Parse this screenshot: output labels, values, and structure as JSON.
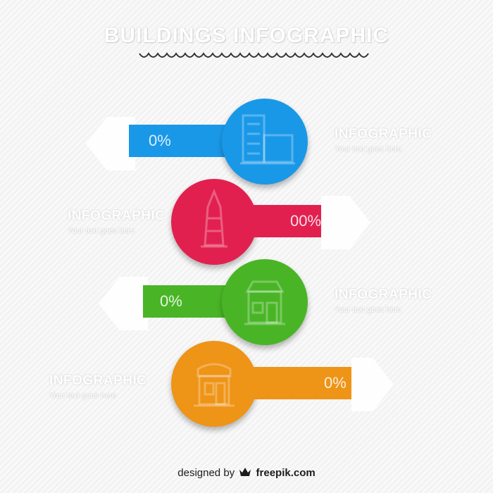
{
  "title": "BUILDINGS INFOGRAPHIC",
  "colors": {
    "blue": "#1a98e8",
    "red": "#e2204f",
    "green": "#49b526",
    "orange": "#ee9416"
  },
  "items": [
    {
      "pct": "0%",
      "label": "INFOGRAPHIC",
      "sub": "Your text goes here",
      "icon": "tower-building-icon",
      "color": "#1a98e8"
    },
    {
      "pct": "00%",
      "label": "INFOGRAPHIC",
      "sub": "Your text goes here",
      "icon": "skyscraper-icon",
      "color": "#e2204f"
    },
    {
      "pct": "0%",
      "label": "INFOGRAPHIC",
      "sub": "Your text goes here",
      "icon": "house-icon",
      "color": "#49b526"
    },
    {
      "pct": "0%",
      "label": "INFOGRAPHIC",
      "sub": "Your text goes here",
      "icon": "shop-icon",
      "color": "#ee9416"
    }
  ],
  "credit": {
    "prefix": "designed by",
    "brand": "freepik.com"
  }
}
